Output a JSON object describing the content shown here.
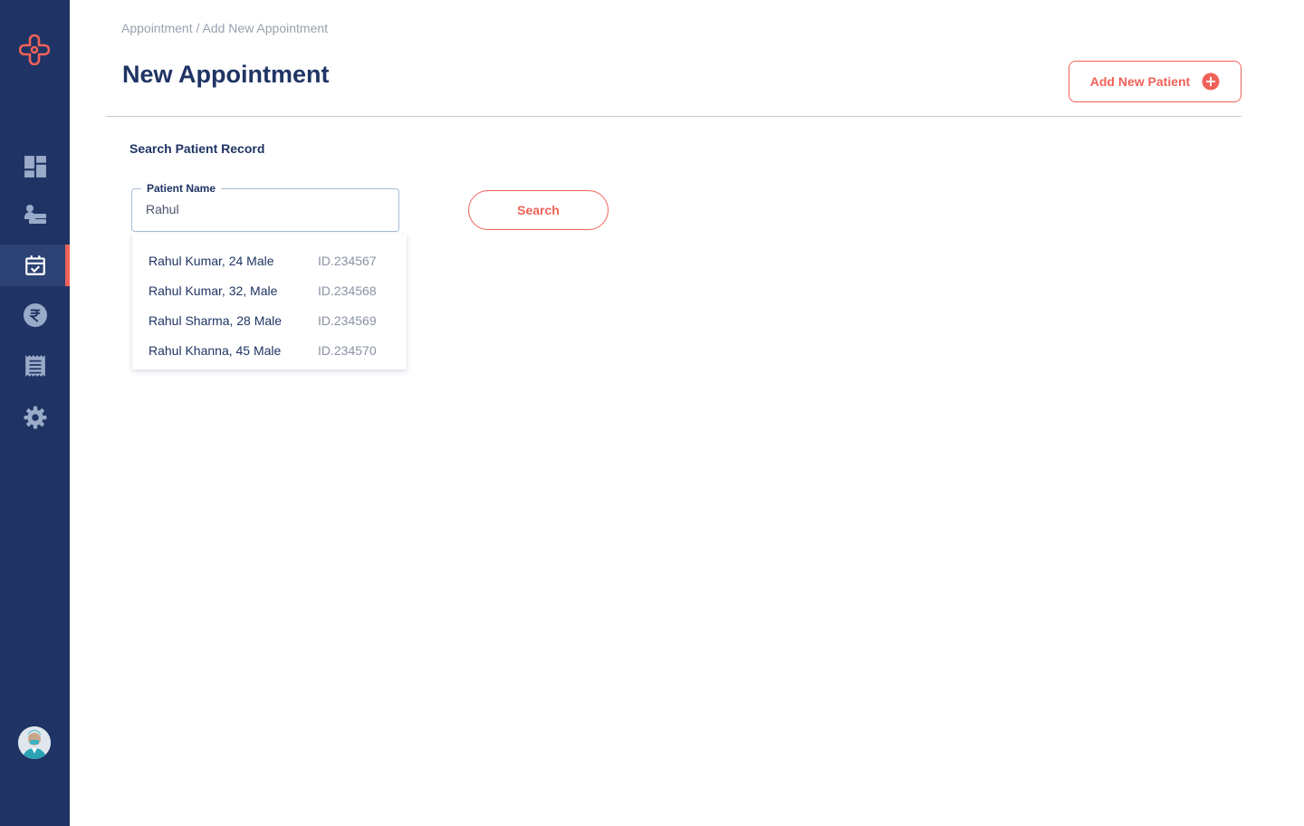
{
  "breadcrumb": "Appointment / Add New Appointment",
  "page_title": "New Appointment",
  "add_patient_label": "Add New Patient",
  "section_title": "Search Patient Record",
  "patient_field": {
    "label": "Patient Name",
    "value": "Rahul"
  },
  "search_label": "Search",
  "suggestions": [
    {
      "name": "Rahul Kumar, 24 Male",
      "id": "ID.234567"
    },
    {
      "name": "Rahul Kumar, 32, Male",
      "id": "ID.234568"
    },
    {
      "name": "Rahul Sharma, 28 Male",
      "id": "ID.234569"
    },
    {
      "name": "Rahul Khanna, 45 Male",
      "id": "ID.234570"
    }
  ],
  "sidebar": {
    "items": [
      {
        "icon": "dashboard-icon"
      },
      {
        "icon": "patients-icon"
      },
      {
        "icon": "calendar-check-icon",
        "active": true
      },
      {
        "icon": "rupee-icon"
      },
      {
        "icon": "receipt-icon"
      },
      {
        "icon": "gear-icon"
      }
    ]
  },
  "colors": {
    "sidebar": "#1f3464",
    "accent": "#f0625a",
    "sidebar_icon": "#9aabc9",
    "title": "#1f3464"
  }
}
